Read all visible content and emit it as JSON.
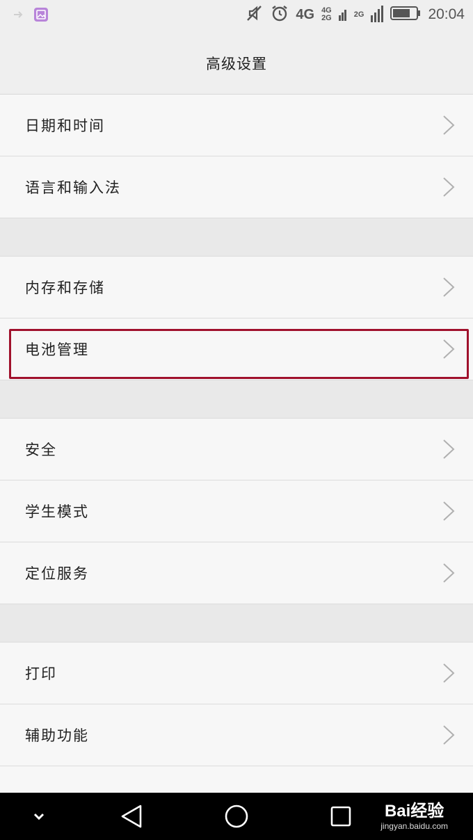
{
  "status_bar": {
    "left_icons": [
      "usb-icon",
      "image-icon"
    ],
    "right_icons": [
      "mute-icon",
      "alarm-icon"
    ],
    "network_primary": "4G",
    "network_sim1_top": "4G",
    "network_sim1_bottom": "2G",
    "network_sim2": "2G",
    "time": "20:04"
  },
  "header": {
    "title": "高级设置"
  },
  "settings": {
    "group1": [
      {
        "label": "日期和时间"
      },
      {
        "label": "语言和输入法"
      }
    ],
    "group2": [
      {
        "label": "内存和存储"
      },
      {
        "label": "电池管理"
      }
    ],
    "group3": [
      {
        "label": "安全"
      },
      {
        "label": "学生模式"
      },
      {
        "label": "定位服务"
      }
    ],
    "group4": [
      {
        "label": "打印"
      },
      {
        "label": "辅助功能"
      }
    ]
  },
  "highlight": {
    "target": "电池管理",
    "color": "#a0112c"
  },
  "nav_bar": {
    "icons": [
      "chevron-down-icon",
      "back-icon",
      "home-icon",
      "recents-icon"
    ]
  },
  "watermark": {
    "brand": "Bai经验",
    "url": "jingyan.baidu.com"
  }
}
